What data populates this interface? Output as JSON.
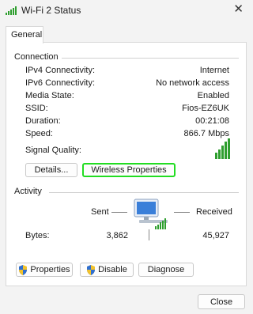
{
  "window": {
    "title": "Wi-Fi 2 Status",
    "close_glyph": "✕"
  },
  "tabs": [
    {
      "label": "General",
      "selected": true
    }
  ],
  "connection": {
    "header": "Connection",
    "rows": [
      {
        "label": "IPv4 Connectivity:",
        "value": "Internet"
      },
      {
        "label": "IPv6 Connectivity:",
        "value": "No network access"
      },
      {
        "label": "Media State:",
        "value": "Enabled"
      },
      {
        "label": "SSID:",
        "value": "Fios-EZ6UK"
      },
      {
        "label": "Duration:",
        "value": "00:21:08"
      },
      {
        "label": "Speed:",
        "value": "866.7 Mbps"
      }
    ],
    "signal_label": "Signal Quality:",
    "signal_bars_lit": 5,
    "signal_bars_total": 5,
    "details_button": "Details...",
    "wireless_button": "Wireless Properties"
  },
  "activity": {
    "header": "Activity",
    "sent_label": "Sent",
    "received_label": "Received",
    "bytes_label": "Bytes:",
    "bytes_sent": "3,862",
    "bytes_received": "45,927"
  },
  "actions": {
    "properties": "Properties",
    "disable": "Disable",
    "diagnose": "Diagnose"
  },
  "footer": {
    "close": "Close"
  },
  "colors": {
    "signal": "#2e9e2e",
    "highlight": "#22dd22",
    "monitor": "#3a7fd9"
  },
  "icons": {
    "title": "wifi-bars-icon",
    "shield": "uac-shield-icon",
    "network": "network-computer-icon"
  }
}
